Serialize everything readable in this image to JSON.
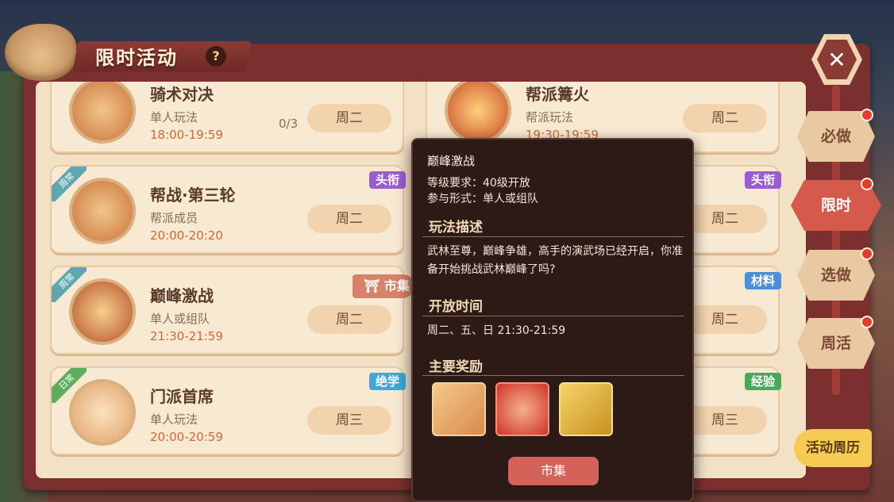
{
  "header": {
    "title": "限时活动",
    "help": "?",
    "close": "✕"
  },
  "left_cards": [
    {
      "name": "骑术对决",
      "type": "单人玩法",
      "time": "18:00-19:59",
      "count": "0/3",
      "day": "周二"
    },
    {
      "name": "帮战·第三轮",
      "type": "帮派成员",
      "time": "20:00-20:20",
      "day": "周二",
      "corner": "周常",
      "tag": "头衔"
    },
    {
      "name": "巅峰激战",
      "type": "单人或组队",
      "time": "21:30-21:59",
      "day": "周二",
      "corner": "周常",
      "shop": "市集"
    },
    {
      "name": "门派首席",
      "type": "单人玩法",
      "time": "20:00-20:59",
      "day": "周三",
      "corner": "日常",
      "tag": "绝学"
    }
  ],
  "right_cards": [
    {
      "name": "帮派篝火",
      "type": "帮派玩法",
      "time": "19:30-19:59",
      "day": "周二"
    },
    {
      "day": "周二",
      "tag": "头衔"
    },
    {
      "day": "周二",
      "tag": "材料"
    },
    {
      "day": "周三",
      "tag": "经验"
    }
  ],
  "side_tabs": [
    "必做",
    "限时",
    "选做",
    "周活"
  ],
  "calendar_button": "活动周历",
  "popup": {
    "title": "巅峰激战",
    "level": "等级要求：40级开放",
    "form": "参与形式：单人或组队",
    "desc_heading": "玩法描述",
    "desc": "武林至尊，巅峰争雄，高手的演武场已经开启，你准备开始挑战武林巅峰了吗?",
    "time_heading": "开放时间",
    "time": "周二、五、日 21:30-21:59",
    "reward_heading": "主要奖励",
    "rewards": [
      "shield-token-icon",
      "red-feather-icon",
      "gold-ingot-icon"
    ],
    "button": "市集"
  },
  "colors": {
    "accent": "#d55a4b",
    "frame": "#7b2f2e",
    "panel": "#f3e1c6"
  }
}
